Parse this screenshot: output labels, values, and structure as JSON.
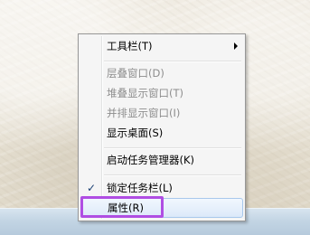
{
  "menu": {
    "items": [
      {
        "label": "工具栏(T)",
        "enabled": true,
        "submenu": true
      },
      {
        "label": "层叠窗口(D)",
        "enabled": false
      },
      {
        "label": "堆叠显示窗口(T)",
        "enabled": false
      },
      {
        "label": "并排显示窗口(I)",
        "enabled": false
      },
      {
        "label": "显示桌面(S)",
        "enabled": true
      },
      {
        "label": "启动任务管理器(K)",
        "enabled": true
      },
      {
        "label": "锁定任务栏(L)",
        "enabled": true,
        "checked": true
      },
      {
        "label": "属性(R)",
        "enabled": true,
        "hovered": true
      }
    ],
    "check_glyph": "✓"
  },
  "colors": {
    "highlight_box": "#b04ee3",
    "disabled_text": "#8d8d8d"
  }
}
